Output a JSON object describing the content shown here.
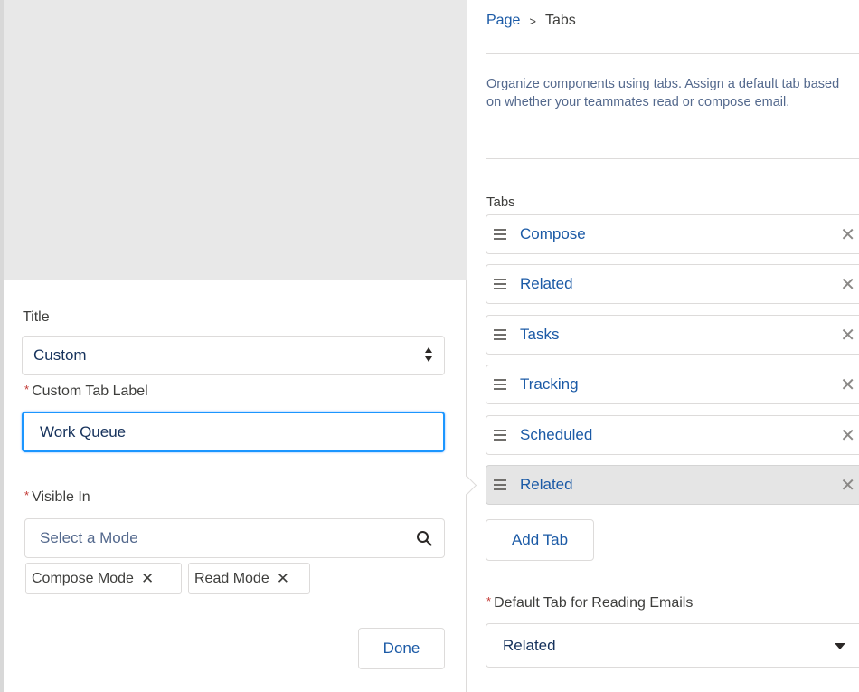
{
  "editor": {
    "title_label": "Title",
    "title_value": "Custom",
    "custom_tab_label": "Custom Tab Label",
    "custom_tab_value": "Work Queue",
    "visible_in_label": "Visible In",
    "mode_placeholder": "Select a Mode",
    "pills": [
      {
        "label": "Compose Mode",
        "remove": "✕"
      },
      {
        "label": "Read Mode",
        "remove": "✕"
      }
    ],
    "required_mark": "*",
    "done_label": "Done"
  },
  "panel": {
    "breadcrumb": {
      "parent": "Page",
      "separator": ">",
      "current": "Tabs"
    },
    "description": "Organize components using tabs. Assign a default tab based on whether your teammates read or compose email.",
    "tabs_heading": "Tabs",
    "tabs": [
      {
        "label": "Compose",
        "remove": "✕"
      },
      {
        "label": "Related",
        "remove": "✕"
      },
      {
        "label": "Tasks",
        "remove": "✕"
      },
      {
        "label": "Tracking",
        "remove": "✕"
      },
      {
        "label": "Scheduled",
        "remove": "✕"
      },
      {
        "label": "Related",
        "remove": "✕",
        "selected": true
      }
    ],
    "add_tab_label": "Add Tab",
    "default_tab_label": "Default Tab for Reading Emails",
    "default_tab_value": "Related"
  },
  "colors": {
    "link_blue": "#1b5aa6",
    "focus_blue": "#1b96ff",
    "required_red": "#c23934",
    "selected_row": "#e5e5e5",
    "canvas_gray": "#e8e8e8"
  },
  "icons": {
    "grip": "drag-handle-icon",
    "remove": "close-icon",
    "search": "search-icon",
    "select_arrows": "up-down-icon",
    "dropdown": "chevron-down-icon"
  }
}
